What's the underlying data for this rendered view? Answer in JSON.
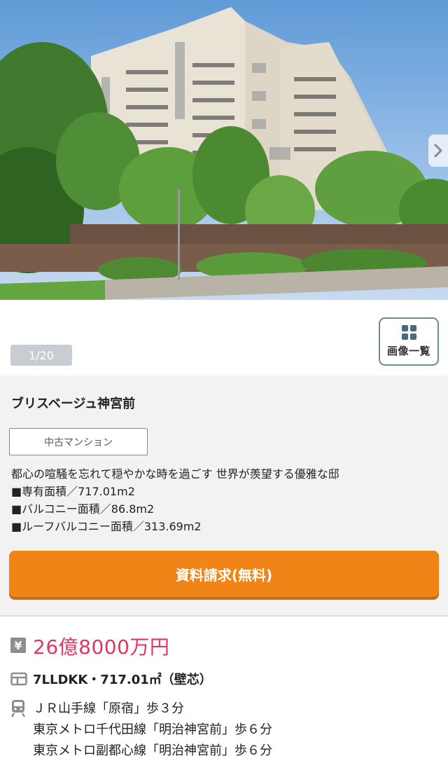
{
  "gallery": {
    "photo_alt": "",
    "counter": "1/20",
    "list_button_label": "画像一覧",
    "next_icon": "chevron-right-icon"
  },
  "property": {
    "name": "ブリスベージュ神宮前",
    "type_tag": "中古マンション",
    "description_lines": [
      "都心の喧騒を忘れて穏やかな時を過ごす 世界が羨望する優雅な邸",
      "■専有面積／717.01m2",
      "■バルコニー面積／86.8m2",
      "■ルーフバルコニー面積／313.69m2"
    ],
    "cta_label": "資料請求(無料)",
    "price_icon": "¥",
    "price": "26億8000万円",
    "layout": "7LLDKK・717.01㎡（壁芯）",
    "access": [
      "ＪＲ山手線「原宿」歩３分",
      "東京メトロ千代田線「明治神宮前」歩６分",
      "東京メトロ副都心線「明治神宮前」歩６分"
    ]
  },
  "colors": {
    "accent_orange": "#f08416",
    "price_pink": "#e2365f",
    "panel_gray": "#f2f2f2"
  }
}
